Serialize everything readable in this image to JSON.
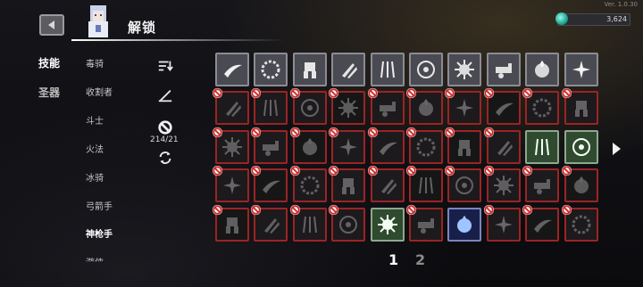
{
  "version": "Ver. 1.0.30",
  "header": {
    "title": "解锁",
    "currency": "3,624"
  },
  "categories": [
    {
      "label": "技能",
      "active": true
    },
    {
      "label": "圣器",
      "active": false
    }
  ],
  "subcategories": [
    {
      "label": "毒骑",
      "active": false
    },
    {
      "label": "收割者",
      "active": false
    },
    {
      "label": "斗士",
      "active": false
    },
    {
      "label": "火法",
      "active": false
    },
    {
      "label": "冰骑",
      "active": false
    },
    {
      "label": "弓箭手",
      "active": false
    },
    {
      "label": "神枪手",
      "active": true
    },
    {
      "label": "游侠",
      "active": false
    }
  ],
  "tools": {
    "progress": "214/21"
  },
  "pagination": {
    "pages": [
      "1",
      "2"
    ],
    "current": "1"
  },
  "icons": [
    "back-arrow-icon",
    "gem-icon",
    "sort-icon",
    "brush-icon",
    "ban-icon",
    "refresh-icon",
    "next-page-icon"
  ],
  "colors": {
    "locked_border": "#9c2424",
    "ban": "#d02a2a",
    "selected_green": "#8fa78f",
    "selected_blue": "#7a86c0"
  },
  "skill_grid": {
    "rows": 5,
    "cols": 10,
    "cells": [
      {
        "state": "unlocked",
        "icon": "slash-arc"
      },
      {
        "state": "unlocked",
        "icon": "twin-blade"
      },
      {
        "state": "unlocked",
        "icon": "burst"
      },
      {
        "state": "unlocked",
        "icon": "spark-star"
      },
      {
        "state": "unlocked",
        "icon": "golem"
      },
      {
        "state": "unlocked",
        "icon": "flower-seal"
      },
      {
        "state": "unlocked",
        "icon": "flame-orb"
      },
      {
        "state": "unlocked",
        "icon": "thorn-ring"
      },
      {
        "state": "unlocked",
        "icon": "arrow-volley"
      },
      {
        "state": "unlocked",
        "icon": "cannon"
      },
      {
        "state": "locked",
        "icon": "crescent"
      },
      {
        "state": "locked",
        "icon": "spike-field"
      },
      {
        "state": "locked",
        "icon": "claw"
      },
      {
        "state": "locked",
        "icon": "cross-star"
      },
      {
        "state": "locked",
        "icon": "scatter-blades"
      },
      {
        "state": "locked",
        "icon": "vortex"
      },
      {
        "state": "locked",
        "icon": "core-orb"
      },
      {
        "state": "locked",
        "icon": "dash-lines"
      },
      {
        "state": "locked",
        "icon": "shards"
      },
      {
        "state": "locked",
        "icon": "scroll"
      },
      {
        "state": "locked",
        "icon": "ring-dash"
      },
      {
        "state": "locked",
        "icon": "feather"
      },
      {
        "state": "locked",
        "icon": "spiral"
      },
      {
        "state": "locked",
        "icon": "comet"
      },
      {
        "state": "locked",
        "icon": "lance"
      },
      {
        "state": "locked",
        "icon": "hand"
      },
      {
        "state": "locked",
        "icon": "pulse-wave"
      },
      {
        "state": "locked",
        "icon": "wedge"
      },
      {
        "state": "selected-green",
        "icon": "thorn-burst"
      },
      {
        "state": "selected-green",
        "icon": "storm-slash"
      },
      {
        "state": "locked",
        "icon": "boots"
      },
      {
        "state": "locked",
        "icon": "flare"
      },
      {
        "state": "locked",
        "icon": "cluster"
      },
      {
        "state": "locked",
        "icon": "biohazard"
      },
      {
        "state": "locked",
        "icon": "rod"
      },
      {
        "state": "locked",
        "icon": "flask"
      },
      {
        "state": "locked",
        "icon": "dragon"
      },
      {
        "state": "locked",
        "icon": "hooks"
      },
      {
        "state": "locked",
        "icon": "bat-wings"
      },
      {
        "state": "locked",
        "icon": "crack"
      },
      {
        "state": "locked",
        "icon": "dust"
      },
      {
        "state": "locked",
        "icon": "leaf"
      },
      {
        "state": "locked",
        "icon": "triskel"
      },
      {
        "state": "locked",
        "icon": "spin"
      },
      {
        "state": "selected-green",
        "icon": "lightning"
      },
      {
        "state": "locked",
        "icon": "twin-orb"
      },
      {
        "state": "selected-blue",
        "icon": "spirit-flame"
      },
      {
        "state": "locked",
        "icon": "tome"
      },
      {
        "state": "locked",
        "icon": "gauntlet"
      },
      {
        "state": "locked",
        "icon": "cannon-rise"
      }
    ]
  }
}
